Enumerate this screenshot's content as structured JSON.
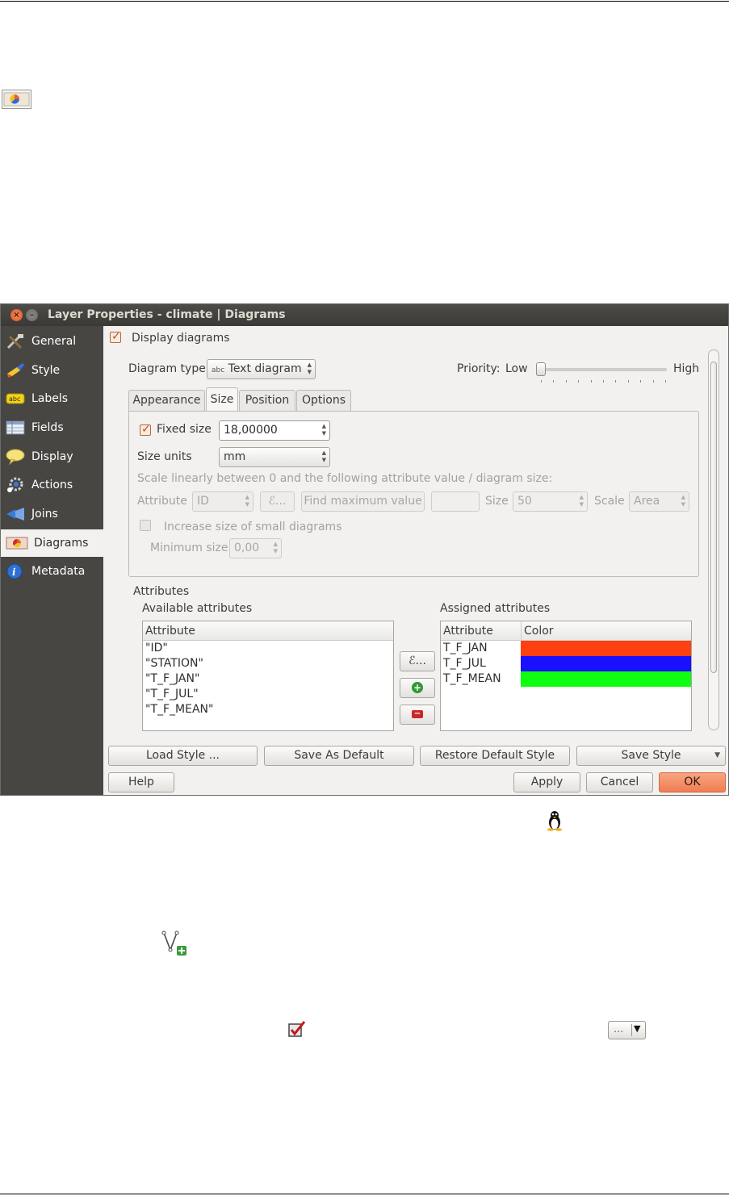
{
  "dialog": {
    "title": "Layer Properties - climate | Diagrams",
    "close_glyph": "×",
    "min_glyph": "–"
  },
  "sidebar": {
    "items": [
      {
        "label": "General",
        "icon": "general-tools-icon"
      },
      {
        "label": "Style",
        "icon": "style-brush-icon"
      },
      {
        "label": "Labels",
        "icon": "labels-abc-icon"
      },
      {
        "label": "Fields",
        "icon": "fields-table-icon"
      },
      {
        "label": "Display",
        "icon": "display-balloon-icon"
      },
      {
        "label": "Actions",
        "icon": "actions-gear-icon"
      },
      {
        "label": "Joins",
        "icon": "joins-icon"
      },
      {
        "label": "Diagrams",
        "icon": "diagrams-icon"
      },
      {
        "label": "Metadata",
        "icon": "metadata-info-icon"
      }
    ],
    "active": "Diagrams"
  },
  "main": {
    "display_diagrams_label": "Display diagrams",
    "display_diagrams_checked": true,
    "diagram_type_label": "Diagram type",
    "diagram_type_icon_text": "abc",
    "diagram_type_value": "Text diagram",
    "priority_label": "Priority:",
    "priority_low": "Low",
    "priority_high": "High",
    "priority_level": 0.0,
    "tabs": [
      "Appearance",
      "Size",
      "Position",
      "Options"
    ],
    "active_tab": "Size",
    "size": {
      "fixed_size_label": "Fixed size",
      "fixed_size_checked": true,
      "fixed_size_value": "18,00000",
      "size_units_label": "Size units",
      "size_units_value": "mm",
      "scale_note": "Scale linearly between 0 and the following attribute value / diagram size:",
      "attribute_label": "Attribute",
      "attribute_value": "ID",
      "expression_button": "ℰ...",
      "find_max_button": "Find maximum value",
      "max_value": "",
      "size_label": "Size",
      "size_value": "50",
      "scale_label": "Scale",
      "scale_value": "Area",
      "increase_small_label": "Increase size of small diagrams",
      "min_size_label": "Minimum size",
      "min_size_value": "0,00"
    },
    "attributes": {
      "section_label": "Attributes",
      "available_label": "Available attributes",
      "available_header": "Attribute",
      "available": [
        "\"ID\"",
        "\"STATION\"",
        "\"T_F_JAN\"",
        "\"T_F_JUL\"",
        "\"T_F_MEAN\""
      ],
      "assigned_label": "Assigned attributes",
      "assigned_headers": [
        "Attribute",
        "Color"
      ],
      "assigned": [
        {
          "name": "T_F_JAN",
          "color": "#ff4010"
        },
        {
          "name": "T_F_JUL",
          "color": "#1a10ff"
        },
        {
          "name": "T_F_MEAN",
          "color": "#10ff10"
        }
      ],
      "expr_button": "ℰ...",
      "add_glyph": "+",
      "remove_glyph": "−"
    }
  },
  "footer": {
    "load_style": "Load Style ...",
    "save_default": "Save As Default",
    "restore_default": "Restore Default Style",
    "save_style": "Save Style",
    "help": "Help",
    "apply": "Apply",
    "cancel": "Cancel",
    "ok": "OK"
  },
  "doc_icons": [
    "diagram-layer-icon",
    "tux-linux-icon",
    "add-vertex-icon",
    "checkbox-checked-icon",
    "dropdown-ellipsis-icon"
  ],
  "doc_ellipsis": "...",
  "doc_dropdown_arrow": "▼"
}
